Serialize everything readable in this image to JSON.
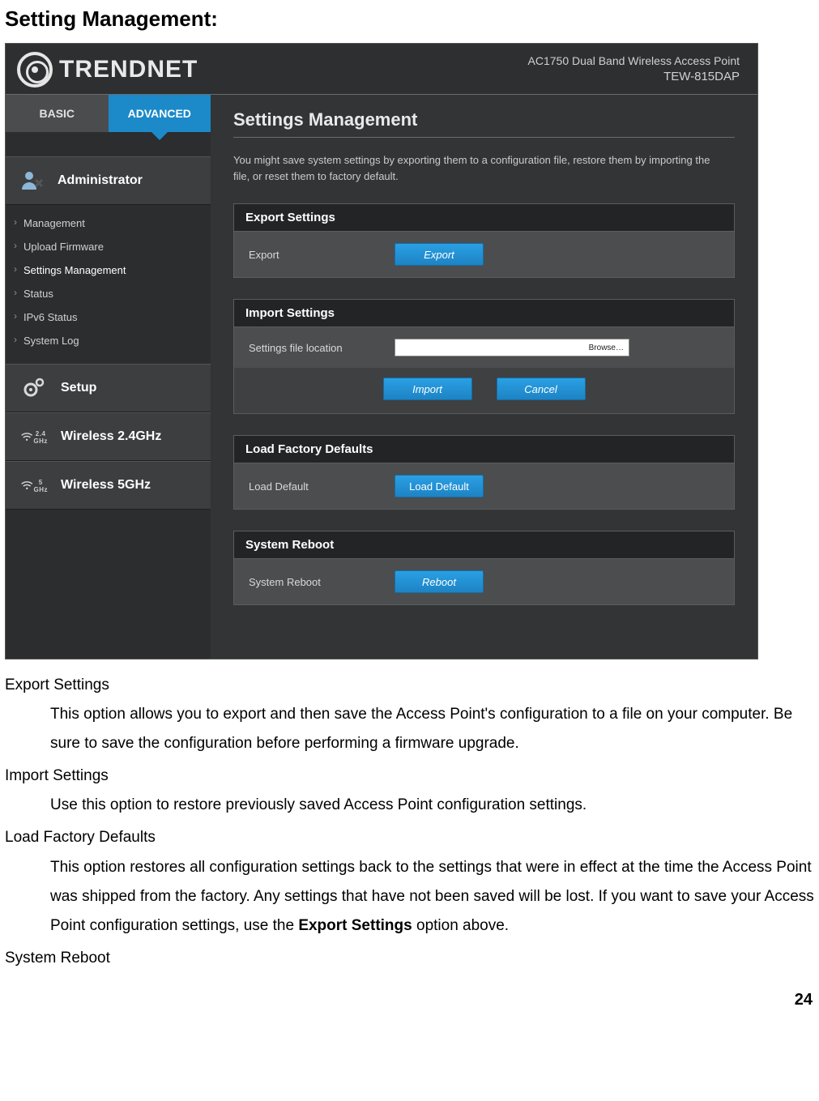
{
  "doc": {
    "heading": "Setting Management:",
    "page_number": "24",
    "sections": [
      {
        "term": "Export Settings",
        "def": "This option allows you to export and then save the Access Point's configuration to a file on your computer. Be sure to save the configuration before performing a firmware upgrade."
      },
      {
        "term": "Import Settings",
        "def": "Use this option to restore previously saved Access Point configuration settings."
      },
      {
        "term": "Load Factory Defaults",
        "def_pre": "This option restores all configuration settings back to the settings that were in effect at the time the Access Point was shipped from the factory. Any settings that have not been saved will be lost. If you want to save your Access Point configuration settings, use the ",
        "def_bold": "Export Settings",
        "def_post": " option above."
      },
      {
        "term": "System Reboot",
        "def": ""
      }
    ]
  },
  "ui": {
    "brand": "TRENDNET",
    "header_line1": "AC1750 Dual Band Wireless Access Point",
    "header_model": "TEW-815DAP",
    "tabs": {
      "basic": "BASIC",
      "advanced": "ADVANCED"
    },
    "sidebar": {
      "admin": "Administrator",
      "items": [
        "Management",
        "Upload Firmware",
        "Settings Management",
        "Status",
        "IPv6 Status",
        "System Log"
      ],
      "setup": "Setup",
      "w24": "Wireless 2.4GHz",
      "w24_band": "2.4 GHz",
      "w5": "Wireless 5GHz",
      "w5_band": "5 GHz"
    },
    "page_title": "Settings Management",
    "description": "You might save system settings by exporting them to a configuration file, restore them by importing the file, or reset them to factory default.",
    "panels": {
      "export": {
        "title": "Export Settings",
        "label": "Export",
        "button": "Export"
      },
      "import": {
        "title": "Import Settings",
        "label": "Settings file location",
        "browse": "Browse…",
        "import_btn": "Import",
        "cancel_btn": "Cancel"
      },
      "factory": {
        "title": "Load Factory Defaults",
        "label": "Load Default",
        "button": "Load Default"
      },
      "reboot": {
        "title": "System Reboot",
        "label": "System Reboot",
        "button": "Reboot"
      }
    }
  }
}
